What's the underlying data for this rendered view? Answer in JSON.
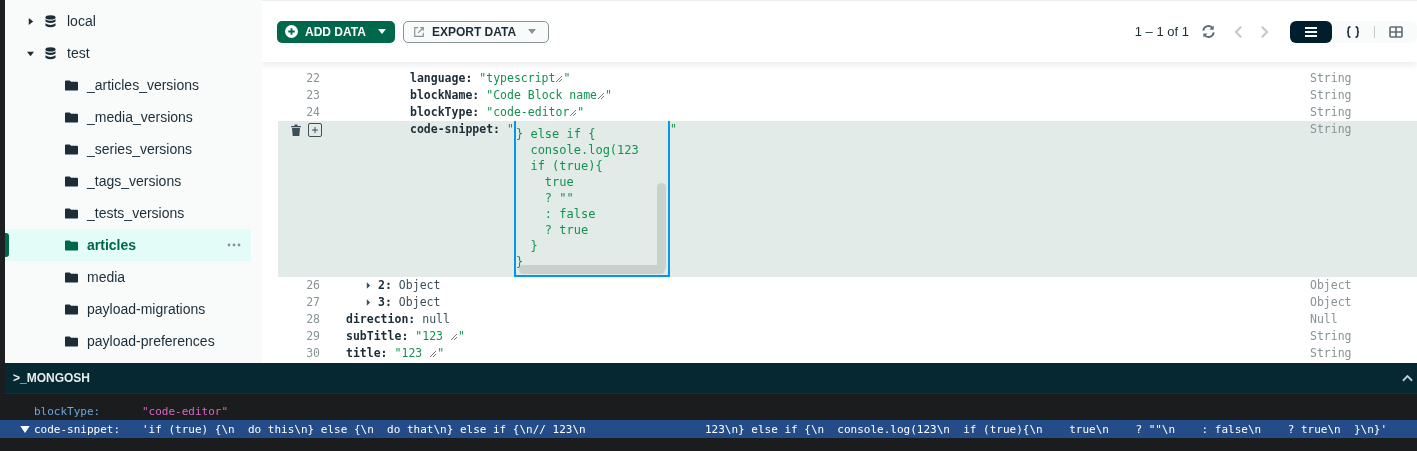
{
  "sidebar": {
    "items": [
      {
        "kind": "database",
        "label": "local",
        "expanded": false,
        "selected": false
      },
      {
        "kind": "database",
        "label": "test",
        "expanded": true,
        "selected": false,
        "children": [
          {
            "kind": "collection",
            "label": "_articles_versions",
            "selected": false
          },
          {
            "kind": "collection",
            "label": "_media_versions",
            "selected": false
          },
          {
            "kind": "collection",
            "label": "_series_versions",
            "selected": false
          },
          {
            "kind": "collection",
            "label": "_tags_versions",
            "selected": false
          },
          {
            "kind": "collection",
            "label": "_tests_versions",
            "selected": false
          },
          {
            "kind": "collection",
            "label": "articles",
            "selected": true
          },
          {
            "kind": "collection",
            "label": "media",
            "selected": false
          },
          {
            "kind": "collection",
            "label": "payload-migrations",
            "selected": false
          },
          {
            "kind": "collection",
            "label": "payload-preferences",
            "selected": false
          }
        ]
      }
    ]
  },
  "toolbar": {
    "add_button": "ADD DATA",
    "export_button": "EXPORT DATA",
    "pagination": "1 – 1 of 1",
    "prev_disabled": true,
    "next_disabled": true,
    "views": [
      {
        "kind": "list",
        "selected": true
      },
      {
        "kind": "json",
        "selected": false
      },
      {
        "kind": "table",
        "selected": false
      }
    ]
  },
  "document": {
    "fields": [
      {
        "children": [
          {
            "children": [
              {
                "children": [
                  {
                    "line": "22",
                    "key": "language:",
                    "kind": "string",
                    "value": "\"typescript",
                    "tail": "\"",
                    "type": "String"
                  },
                  {
                    "line": "23",
                    "key": "blockName:",
                    "kind": "string",
                    "value": "\"Code Block name",
                    "tail": "\"",
                    "type": "String"
                  },
                  {
                    "line": "24",
                    "key": "blockType:",
                    "kind": "string",
                    "value": "\"code-editor",
                    "tail": "\"",
                    "type": "String"
                  },
                  {
                    "key": "code-snippet:",
                    "kind": "editing",
                    "value": "\"",
                    "tail": "\"",
                    "type": "String",
                    "editor": "} else if {\n  console.log(123\n  if (true){\n    true\n    ? \"\"\n    : false\n    ? true\n  }\n}"
                  }
                ]
              },
              {
                "line": "26",
                "key": "2:",
                "kind": "object",
                "value": "Object",
                "expanded": false,
                "type": "Object"
              },
              {
                "line": "27",
                "key": "3:",
                "kind": "object",
                "value": "Object",
                "expanded": false,
                "type": "Object"
              }
            ]
          },
          {
            "line": "28",
            "key": "direction:",
            "kind": "null",
            "value": "null",
            "type": "Null"
          }
        ]
      },
      {
        "line": "29",
        "key": "subTitle:",
        "kind": "string",
        "value": "\"123 ",
        "tail": "\"",
        "type": "String"
      },
      {
        "line": "30",
        "key": "title:",
        "kind": "string",
        "value": "\"123 ",
        "tail": "\"",
        "type": "String"
      }
    ]
  },
  "shell": {
    "title": ">_MONGOSH",
    "expanded": true,
    "rows": [
      {
        "key": "blockType:",
        "value": "\"code-editor\"",
        "selected": false
      },
      {
        "key": "code-snippet:",
        "value": "'if (true) {\\n  do this\\n} else {\\n  do that\\n} else if {\\n// 123\\n                  123\\n} else if {\\n  console.log(123\\n  if (true){\\n    true\\n    ? \"\"\\n    : false\\n    ? true\\n  }\\n}'",
        "selected": true,
        "expanded": true
      }
    ]
  }
}
